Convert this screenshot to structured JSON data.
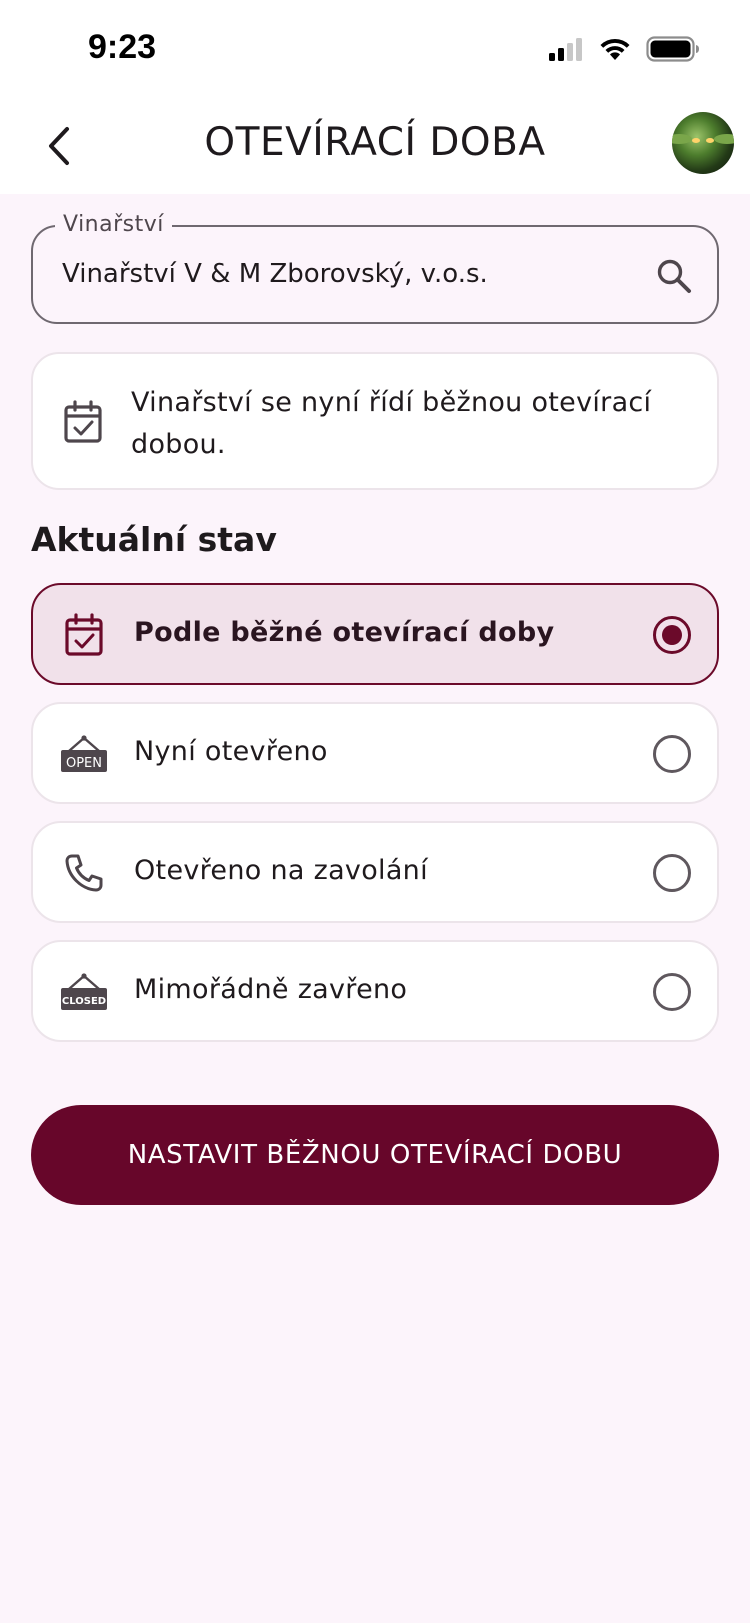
{
  "status_bar": {
    "time": "9:23"
  },
  "app_bar": {
    "title": "OTEVÍRACÍ DOBA"
  },
  "winery_field": {
    "label": "Vinařství",
    "value": "Vinařství V & M Zborovský, v.o.s."
  },
  "info": {
    "text": "Vinařství se nyní řídí běžnou otevírací dobou."
  },
  "section": {
    "title": "Aktuální stav"
  },
  "options": [
    {
      "label": "Podle běžné otevírací doby",
      "icon": "calendar-check-icon",
      "selected": true
    },
    {
      "label": "Nyní otevřeno",
      "icon": "open-sign-icon",
      "icon_text": "OPEN",
      "selected": false
    },
    {
      "label": "Otevřeno na zavolání",
      "icon": "phone-icon",
      "selected": false
    },
    {
      "label": "Mimořádně zavřeno",
      "icon": "closed-sign-icon",
      "icon_text": "CLOSED",
      "selected": false
    }
  ],
  "cta": {
    "label": "NASTAVIT BĚŽNOU OTEVÍRACÍ DOBU"
  },
  "colors": {
    "primary": "#67062a",
    "background": "#fcf4fb",
    "selected_bg": "#f1e1ea"
  }
}
